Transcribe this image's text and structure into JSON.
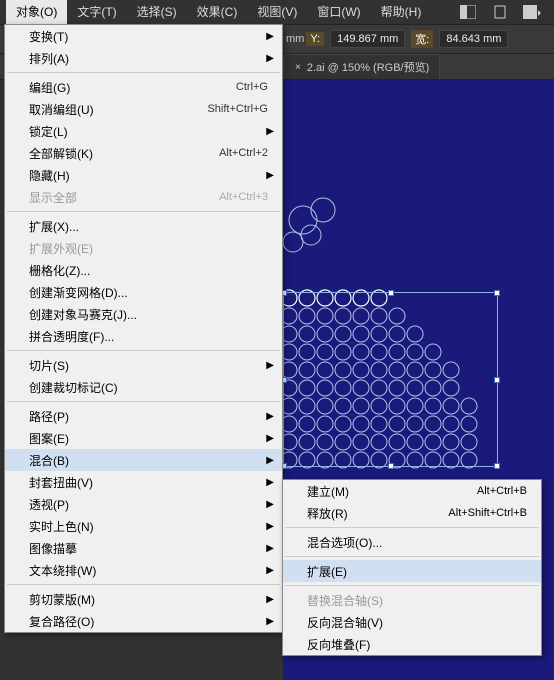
{
  "menubar": {
    "items": [
      "对象(O)",
      "文字(T)",
      "选择(S)",
      "效果(C)",
      "视图(V)",
      "窗口(W)",
      "帮助(H)"
    ]
  },
  "control": {
    "x_unit": "mm",
    "y_label": "Y:",
    "y_value": "149.867",
    "y_unit": "mm",
    "w_label": "宽:",
    "w_value": "84.643",
    "w_unit": "mm"
  },
  "tab": {
    "title": "2.ai @ 150% (RGB/预览)"
  },
  "menu": {
    "transform": "变换(T)",
    "arrange": "排列(A)",
    "group": "编组(G)",
    "group_sc": "Ctrl+G",
    "ungroup": "取消编组(U)",
    "ungroup_sc": "Shift+Ctrl+G",
    "lock": "锁定(L)",
    "unlock_all": "全部解锁(K)",
    "unlock_all_sc": "Alt+Ctrl+2",
    "hide": "隐藏(H)",
    "show_all": "显示全部",
    "show_all_sc": "Alt+Ctrl+3",
    "expand": "扩展(X)...",
    "expand_appearance": "扩展外观(E)",
    "rasterize": "栅格化(Z)...",
    "gradient_mesh": "创建渐变网格(D)...",
    "object_mosaic": "创建对象马赛克(J)...",
    "flatten": "拼合透明度(F)...",
    "slice": "切片(S)",
    "crop_marks": "创建裁切标记(C)",
    "path": "路径(P)",
    "pattern": "图案(E)",
    "blend": "混合(B)",
    "envelope": "封套扭曲(V)",
    "perspective": "透视(P)",
    "live_paint": "实时上色(N)",
    "image_trace": "图像描摹",
    "text_wrap": "文本绕排(W)",
    "clip_mask": "剪切蒙版(M)",
    "compound": "复合路径(O)"
  },
  "submenu": {
    "make": "建立(M)",
    "make_sc": "Alt+Ctrl+B",
    "release": "释放(R)",
    "release_sc": "Alt+Shift+Ctrl+B",
    "options": "混合选项(O)...",
    "expand": "扩展(E)",
    "replace_spine": "替换混合轴(S)",
    "reverse_spine": "反向混合轴(V)",
    "reverse_stack": "反向堆叠(F)"
  }
}
